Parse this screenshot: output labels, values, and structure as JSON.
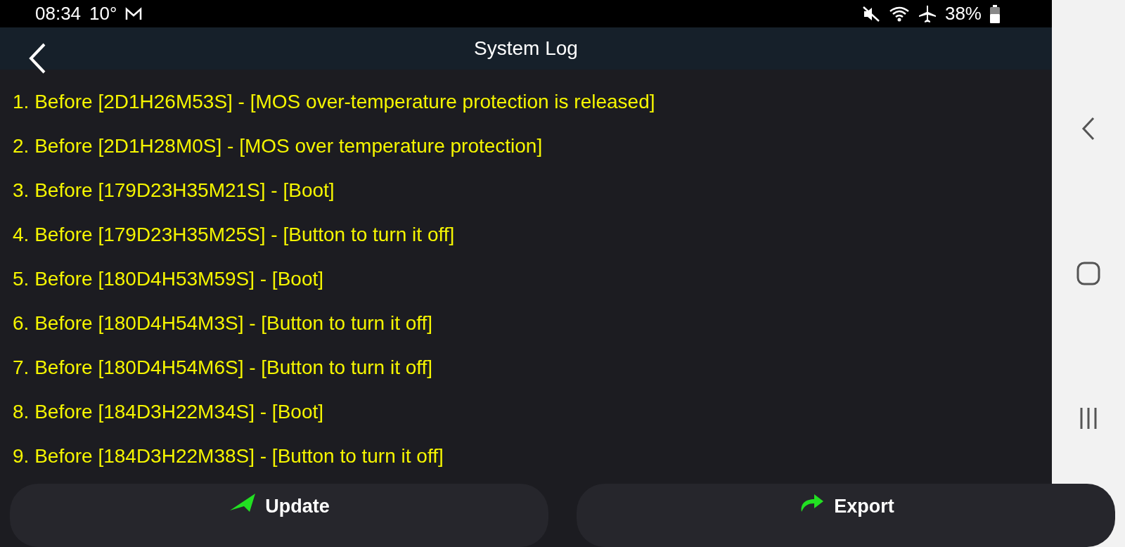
{
  "status_bar": {
    "time": "08:34",
    "temperature": "10°",
    "battery": "38%"
  },
  "header": {
    "title": "System Log"
  },
  "log_entries": [
    "1. Before [2D1H26M53S] - [MOS over-temperature protection is released]",
    "2. Before [2D1H28M0S] - [MOS over temperature protection]",
    "3. Before [179D23H35M21S] - [Boot]",
    "4. Before [179D23H35M25S] - [Button to turn it off]",
    "5. Before [180D4H53M59S] - [Boot]",
    "6. Before [180D4H54M3S] - [Button to turn it off]",
    "7. Before [180D4H54M6S] - [Button to turn it off]",
    "8. Before [184D3H22M34S] - [Boot]",
    "9. Before [184D3H22M38S] - [Button to turn it off]"
  ],
  "actions": [
    {
      "kind": "update",
      "label": "Update"
    },
    {
      "kind": "export",
      "label": "Export"
    }
  ]
}
